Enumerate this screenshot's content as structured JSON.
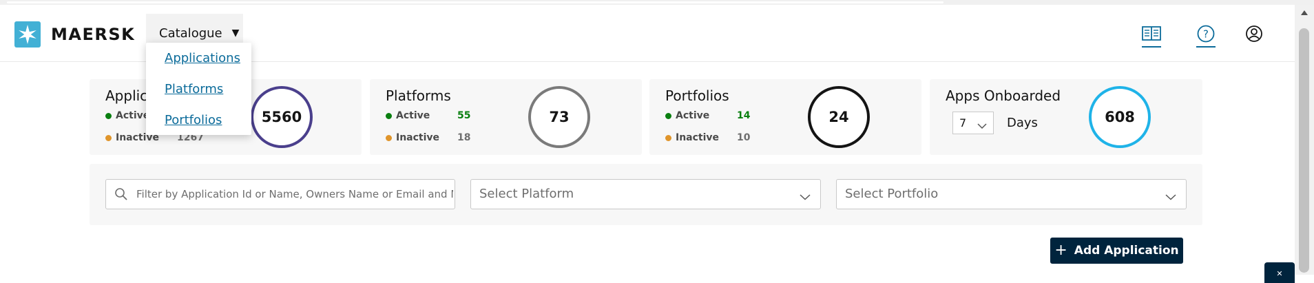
{
  "header": {
    "brand": "MAERSK",
    "menu_label": "Catalogue",
    "menu_items": [
      "Applications",
      "Platforms",
      "Portfolios"
    ],
    "icons": [
      "book-icon",
      "help-icon",
      "user-icon"
    ]
  },
  "cards": [
    {
      "title": "Applications",
      "active_label": "Active",
      "active_value": "",
      "inactive_label": "Inactive",
      "inactive_value": "1267",
      "total": "5560"
    },
    {
      "title": "Platforms",
      "active_label": "Active",
      "active_value": "55",
      "inactive_label": "Inactive",
      "inactive_value": "18",
      "total": "73"
    },
    {
      "title": "Portfolios",
      "active_label": "Active",
      "active_value": "14",
      "inactive_label": "Inactive",
      "inactive_value": "10",
      "total": "24"
    },
    {
      "title": "Apps Onboarded",
      "days_value": "7",
      "days_label": "Days",
      "total": "608"
    }
  ],
  "filters": {
    "search_placeholder": "Filter by Application Id or Name, Owners Name or Email and MVC.",
    "platform_placeholder": "Select Platform",
    "portfolio_placeholder": "Select Portfolio"
  },
  "actions": {
    "add_label": "Add Application"
  },
  "colors": {
    "brand_blue": "#42b0d5",
    "active_green": "#0a7f10",
    "inactive_orange": "#e0952b",
    "link_blue": "#0b6b9a",
    "dark_navy": "#00243d",
    "ring_apps": "#4a3f8c",
    "ring_platforms": "#7a7a7a",
    "ring_portfolios": "#141414",
    "ring_onboarded": "#1fb3e8"
  }
}
